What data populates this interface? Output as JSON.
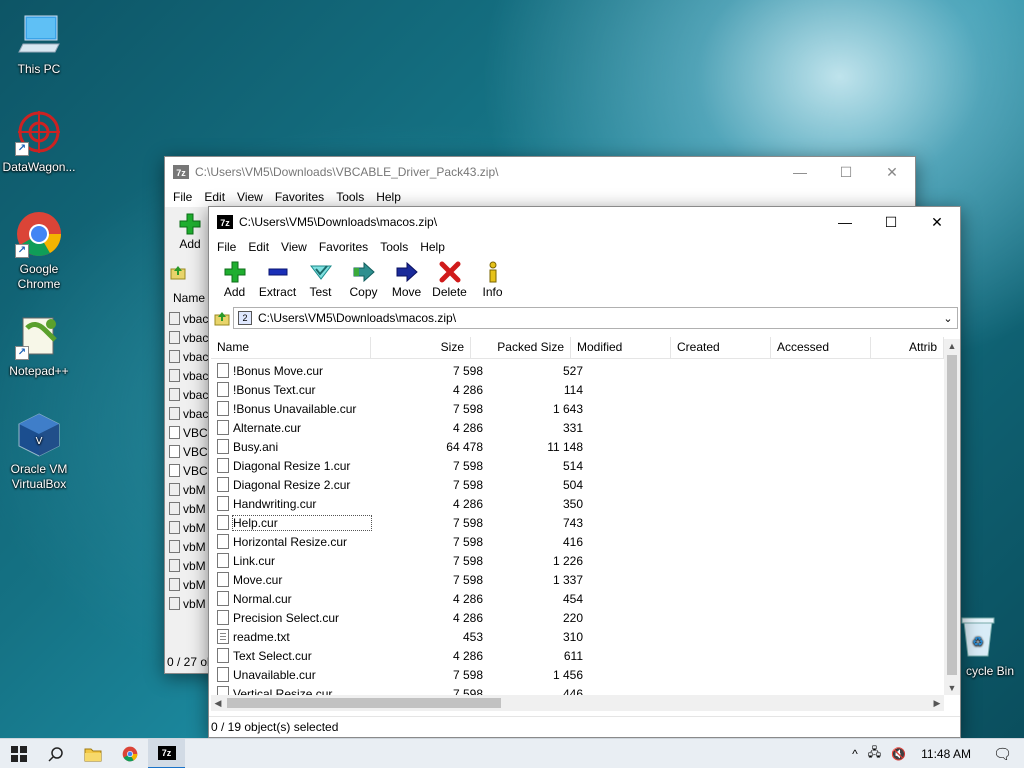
{
  "desktop": {
    "icons": [
      {
        "label": "This PC"
      },
      {
        "label": "DataWagon..."
      },
      {
        "label": "Google Chrome"
      },
      {
        "label": "Notepad++"
      },
      {
        "label": "Oracle VM VirtualBox"
      },
      {
        "label": "Recycle Bin",
        "visible_label": "cycle Bin"
      }
    ]
  },
  "back_window": {
    "title": "C:\\Users\\VM5\\Downloads\\VBCABLE_Driver_Pack43.zip\\",
    "menu": [
      "File",
      "Edit",
      "View",
      "Favorites",
      "Tools",
      "Help"
    ],
    "add_label": "Add",
    "name_header": "Name",
    "items": [
      "vbac",
      "vbac",
      "vbac",
      "vbac",
      "vbac",
      "vbac",
      "VBC",
      "VBC",
      "VBC",
      "vbM",
      "vbM",
      "vbM",
      "vbM",
      "vbM",
      "vbM",
      "vbM"
    ],
    "status": "0 / 27 ob"
  },
  "front_window": {
    "title": "C:\\Users\\VM5\\Downloads\\macos.zip\\",
    "menu": [
      "File",
      "Edit",
      "View",
      "Favorites",
      "Tools",
      "Help"
    ],
    "toolbar": [
      "Add",
      "Extract",
      "Test",
      "Copy",
      "Move",
      "Delete",
      "Info"
    ],
    "address": "C:\\Users\\VM5\\Downloads\\macos.zip\\",
    "columns": [
      "Name",
      "Size",
      "Packed Size",
      "Modified",
      "Created",
      "Accessed",
      "Attrib"
    ],
    "files": [
      {
        "name": "!Bonus  Move.cur",
        "size": "7 598",
        "packed": "527"
      },
      {
        "name": "!Bonus  Text.cur",
        "size": "4 286",
        "packed": "114"
      },
      {
        "name": "!Bonus  Unavailable.cur",
        "size": "7 598",
        "packed": "1 643"
      },
      {
        "name": "Alternate.cur",
        "size": "4 286",
        "packed": "331"
      },
      {
        "name": "Busy.ani",
        "size": "64 478",
        "packed": "11 148"
      },
      {
        "name": "Diagonal Resize 1.cur",
        "size": "7 598",
        "packed": "514"
      },
      {
        "name": "Diagonal Resize 2.cur",
        "size": "7 598",
        "packed": "504"
      },
      {
        "name": "Handwriting.cur",
        "size": "4 286",
        "packed": "350"
      },
      {
        "name": "Help.cur",
        "size": "7 598",
        "packed": "743"
      },
      {
        "name": "Horizontal Resize.cur",
        "size": "7 598",
        "packed": "416"
      },
      {
        "name": "Link.cur",
        "size": "7 598",
        "packed": "1 226"
      },
      {
        "name": "Move.cur",
        "size": "7 598",
        "packed": "1 337"
      },
      {
        "name": "Normal.cur",
        "size": "4 286",
        "packed": "454"
      },
      {
        "name": "Precision Select.cur",
        "size": "4 286",
        "packed": "220"
      },
      {
        "name": "readme.txt",
        "size": "453",
        "packed": "310"
      },
      {
        "name": "Text Select.cur",
        "size": "4 286",
        "packed": "611"
      },
      {
        "name": "Unavailable.cur",
        "size": "7 598",
        "packed": "1 456"
      },
      {
        "name": "Vertical Resize.cur",
        "size": "7 598",
        "packed": "446"
      }
    ],
    "status": "0 / 19 object(s) selected"
  },
  "taskbar": {
    "time": "11:48 AM"
  },
  "colors": {
    "add_green": "#1fae2f",
    "extract_blue": "#1a2fb8",
    "test_teal": "#27b5b5",
    "delete_red": "#d01a1a",
    "taskbar_bg": "#e9eef3"
  }
}
